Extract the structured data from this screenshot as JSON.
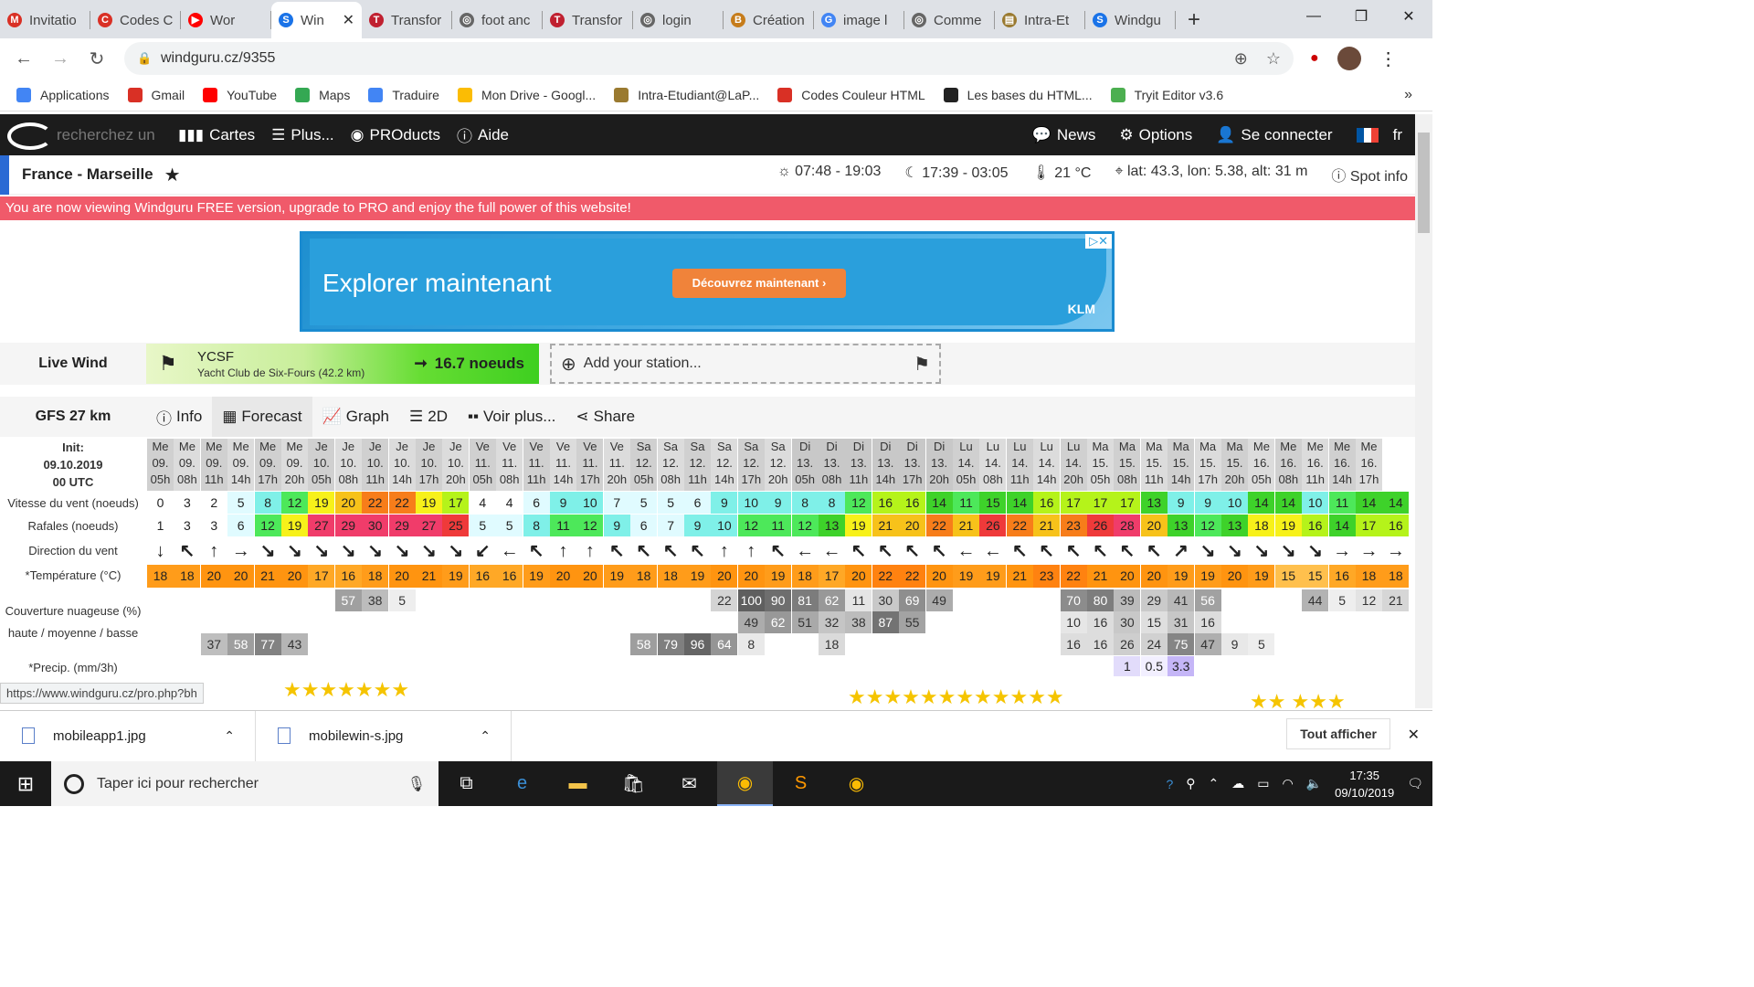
{
  "browser": {
    "tabs": [
      {
        "label": "Invitatio",
        "color": "#d93025",
        "glyph": "M"
      },
      {
        "label": "Codes C",
        "color": "#d93025",
        "glyph": "C"
      },
      {
        "label": "Wor",
        "color": "#ff0000",
        "glyph": "▶"
      },
      {
        "label": "Win",
        "color": "#1a73e8",
        "glyph": "S",
        "active": true
      },
      {
        "label": "Transfor",
        "color": "#c02030",
        "glyph": "T"
      },
      {
        "label": "foot anc",
        "color": "#666",
        "glyph": "◎"
      },
      {
        "label": "Transfor",
        "color": "#c02030",
        "glyph": "T"
      },
      {
        "label": "login",
        "color": "#666",
        "glyph": "◎"
      },
      {
        "label": "Création",
        "color": "#c67c1b",
        "glyph": "B"
      },
      {
        "label": "image l",
        "color": "#4285f4",
        "glyph": "G"
      },
      {
        "label": "Comme",
        "color": "#666",
        "glyph": "◎"
      },
      {
        "label": "Intra-Et",
        "color": "#9a7a30",
        "glyph": "▤"
      },
      {
        "label": "Windgu",
        "color": "#1a73e8",
        "glyph": "S"
      }
    ],
    "url": "windguru.cz/9355",
    "bookmarks": [
      {
        "label": "Applications",
        "color": "#4285f4"
      },
      {
        "label": "Gmail",
        "color": "#d93025"
      },
      {
        "label": "YouTube",
        "color": "#ff0000"
      },
      {
        "label": "Maps",
        "color": "#34a853"
      },
      {
        "label": "Traduire",
        "color": "#4285f4"
      },
      {
        "label": "Mon Drive - Googl...",
        "color": "#fbbc04"
      },
      {
        "label": "Intra-Etudiant@LaP...",
        "color": "#9a7a30"
      },
      {
        "label": "Codes Couleur HTML",
        "color": "#d93025"
      },
      {
        "label": "Les bases du HTML...",
        "color": "#222"
      },
      {
        "label": "Tryit Editor v3.6",
        "color": "#4caf50"
      }
    ]
  },
  "wg": {
    "search": "recherchez un",
    "nav": [
      "Cartes",
      "Plus...",
      "PROducts",
      "Aide"
    ],
    "right": [
      "News",
      "Options",
      "Se connecter",
      "fr"
    ],
    "spot": "France - Marseille",
    "sun": "07:48 - 19:03",
    "moon": "17:39 - 03:05",
    "temp": "21 °C",
    "coords": "lat: 43.3, lon: 5.38, alt: 31 m",
    "spotinfo": "Spot info",
    "banner": "You are now viewing Windguru FREE version, upgrade to PRO and enjoy the full power of this website!",
    "ad": {
      "headline": "Explorer maintenant",
      "button": "Découvrez maintenant",
      "brand": "KLM"
    },
    "live": {
      "label": "Live Wind",
      "station": "YCSF",
      "desc": "Yacht Club de Six-Fours",
      "dist": "(42.2 km)",
      "value": "16.7 noeuds",
      "add": "Add your station..."
    },
    "model": "GFS 27 km",
    "ftabs": [
      "Info",
      "Forecast",
      "Graph",
      "2D",
      "Voir plus...",
      "Share"
    ],
    "init": [
      "Init:",
      "09.10.2019",
      "00 UTC"
    ],
    "rowlabels": [
      "Vitesse du vent (noeuds)",
      "Rafales (noeuds)",
      "Direction du vent",
      "*Température (°C)",
      "Couverture nuageuse (%)",
      "haute / moyenne / basse",
      "*Precip. (mm/3h)"
    ],
    "days": [
      "Me",
      "Me",
      "Me",
      "Me",
      "Me",
      "Me",
      "Je",
      "Je",
      "Je",
      "Je",
      "Je",
      "Je",
      "Ve",
      "Ve",
      "Ve",
      "Ve",
      "Ve",
      "Ve",
      "Sa",
      "Sa",
      "Sa",
      "Sa",
      "Sa",
      "Sa",
      "Di",
      "Di",
      "Di",
      "Di",
      "Di",
      "Di",
      "Lu",
      "Lu",
      "Lu",
      "Lu",
      "Lu",
      "Ma",
      "Ma",
      "Ma",
      "Ma",
      "Ma",
      "Ma",
      "Me",
      "Me",
      "Me",
      "Me",
      "Me"
    ],
    "dates": [
      "09.",
      "09.",
      "09.",
      "09.",
      "09.",
      "09.",
      "10.",
      "10.",
      "10.",
      "10.",
      "10.",
      "10.",
      "11.",
      "11.",
      "11.",
      "11.",
      "11.",
      "11.",
      "12.",
      "12.",
      "12.",
      "12.",
      "12.",
      "12.",
      "13.",
      "13.",
      "13.",
      "13.",
      "13.",
      "13.",
      "14.",
      "14.",
      "14.",
      "14.",
      "14.",
      "15.",
      "15.",
      "15.",
      "15.",
      "15.",
      "15.",
      "16.",
      "16.",
      "16.",
      "16.",
      "16."
    ],
    "hours": [
      "05h",
      "08h",
      "11h",
      "14h",
      "17h",
      "20h",
      "05h",
      "08h",
      "11h",
      "14h",
      "17h",
      "20h",
      "05h",
      "08h",
      "11h",
      "14h",
      "17h",
      "20h",
      "05h",
      "08h",
      "11h",
      "14h",
      "17h",
      "20h",
      "05h",
      "08h",
      "11h",
      "14h",
      "17h",
      "20h",
      "05h",
      "08h",
      "11h",
      "14h",
      "20h",
      "05h",
      "08h",
      "11h",
      "14h",
      "17h",
      "20h",
      "05h",
      "08h",
      "11h",
      "14h",
      "17h"
    ],
    "wind": [
      "0",
      "3",
      "2",
      "5",
      "8",
      "12",
      "19",
      "20",
      "22",
      "22",
      "19",
      "17",
      "4",
      "4",
      "6",
      "9",
      "10",
      "7",
      "5",
      "5",
      "6",
      "9",
      "10",
      "9",
      "8",
      "8",
      "12",
      "16",
      "16",
      "14",
      "11",
      "15",
      "14",
      "16",
      "17",
      "17",
      "17",
      "13",
      "9",
      "9",
      "10",
      "14",
      "14",
      "10",
      "11",
      "14",
      "14"
    ],
    "gust": [
      "1",
      "3",
      "3",
      "6",
      "12",
      "19",
      "27",
      "29",
      "30",
      "29",
      "27",
      "25",
      "5",
      "5",
      "8",
      "11",
      "12",
      "9",
      "6",
      "7",
      "9",
      "10",
      "12",
      "11",
      "12",
      "13",
      "19",
      "21",
      "20",
      "22",
      "21",
      "26",
      "22",
      "21",
      "23",
      "26",
      "28",
      "20",
      "13",
      "12",
      "13",
      "18",
      "19",
      "16",
      "14",
      "17",
      "16"
    ],
    "dir": [
      "↓",
      "↖",
      "↑",
      "→",
      "↘",
      "↘",
      "↘",
      "↘",
      "↘",
      "↘",
      "↘",
      "↘",
      "↙",
      "←",
      "↖",
      "↑",
      "↑",
      "↖",
      "↖",
      "↖",
      "↖",
      "↑",
      "↑",
      "↖",
      "←",
      "←",
      "↖",
      "↖",
      "↖",
      "↖",
      "←",
      "←",
      "↖",
      "↖",
      "↖",
      "↖",
      "↖",
      "↖",
      "↗",
      "↘",
      "↘",
      "↘",
      "↘",
      "↘",
      "→",
      "→",
      "→"
    ],
    "temps": [
      "18",
      "18",
      "20",
      "20",
      "21",
      "20",
      "17",
      "16",
      "18",
      "20",
      "21",
      "19",
      "16",
      "16",
      "19",
      "20",
      "20",
      "19",
      "18",
      "18",
      "19",
      "20",
      "20",
      "19",
      "18",
      "17",
      "20",
      "22",
      "22",
      "20",
      "19",
      "19",
      "21",
      "23",
      "22",
      "21",
      "20",
      "20",
      "19",
      "19",
      "20",
      "19",
      "15",
      "15",
      "16",
      "18",
      "18"
    ],
    "cloudHigh": [
      "",
      "",
      "",
      "",
      "",
      "",
      "",
      "57",
      "38",
      "5",
      "",
      "",
      "",
      "",
      "",
      "",
      "",
      "",
      "",
      "",
      "",
      "22",
      "100",
      "90",
      "81",
      "62",
      "11",
      "30",
      "69",
      "49",
      "",
      "",
      "",
      "",
      "70",
      "80",
      "39",
      "29",
      "41",
      "56",
      "",
      "",
      "",
      "44",
      "5",
      "12",
      "21"
    ],
    "cloudMid": [
      "",
      "",
      "",
      "",
      "",
      "",
      "",
      "",
      "",
      "",
      "",
      "",
      "",
      "",
      "",
      "",
      "",
      "",
      "",
      "",
      "",
      "",
      "49",
      "62",
      "51",
      "32",
      "38",
      "87",
      "55",
      "",
      "",
      "",
      "",
      "",
      "10",
      "16",
      "30",
      "15",
      "31",
      "16",
      "",
      "",
      "",
      "",
      "",
      "",
      ""
    ],
    "cloudLow": [
      "",
      "",
      "37",
      "58",
      "77",
      "43",
      "",
      "",
      "",
      "",
      "",
      "",
      "",
      "",
      "",
      "",
      "",
      "",
      "58",
      "79",
      "96",
      "64",
      "8",
      "",
      "",
      "18",
      "",
      "",
      "",
      "",
      "",
      "",
      "",
      "",
      "16",
      "16",
      "26",
      "24",
      "75",
      "47",
      "9",
      "5",
      "",
      "",
      "",
      "",
      ""
    ],
    "precip": [
      "",
      "",
      "",
      "",
      "",
      "",
      "",
      "",
      "",
      "",
      "",
      "",
      "",
      "",
      "",
      "",
      "",
      "",
      "",
      "",
      "",
      "",
      "",
      "",
      "",
      "",
      "",
      "",
      "",
      "",
      "",
      "",
      "",
      "",
      "",
      "",
      "1",
      "0.5",
      "3.3",
      "",
      "",
      "",
      "",
      "",
      "",
      ""
    ]
  },
  "status": {
    "url": "https://www.windguru.cz/pro.php?bh"
  },
  "downloads": {
    "items": [
      "mobileapp1.jpg",
      "mobilewin-s.jpg"
    ],
    "showall": "Tout afficher"
  },
  "taskbar": {
    "search": "Taper ici pour rechercher",
    "time": "17:35",
    "date": "09/10/2019"
  }
}
